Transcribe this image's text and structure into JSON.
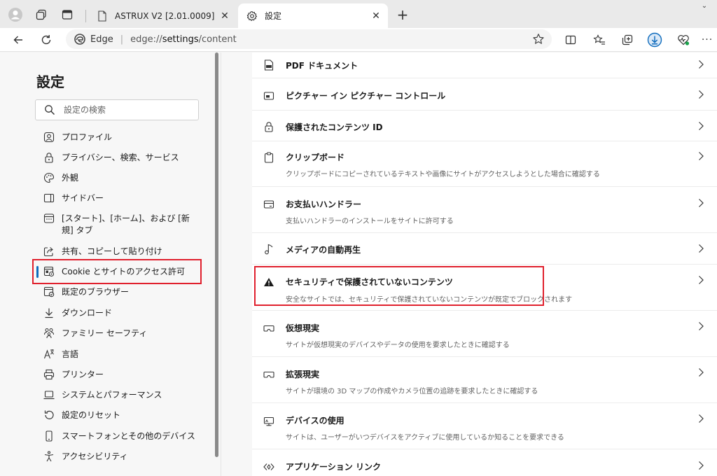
{
  "tabs": [
    {
      "title": "ASTRUX V2 [2.01.0009]",
      "icon": "document-icon",
      "active": false
    },
    {
      "title": "設定",
      "icon": "gear-icon",
      "active": true
    }
  ],
  "address_bar": {
    "site_label": "Edge",
    "url_prefix": "edge://",
    "url_path": "settings",
    "url_suffix": "/content"
  },
  "sidebar": {
    "title": "設定",
    "search_placeholder": "設定の検索",
    "items": [
      {
        "label": "プロファイル",
        "icon": "profile-icon"
      },
      {
        "label": "プライバシー、検索、サービス",
        "icon": "lock-icon"
      },
      {
        "label": "外観",
        "icon": "palette-icon"
      },
      {
        "label": "サイドバー",
        "icon": "sidebar-icon"
      },
      {
        "label": "[スタート]、[ホーム]、および [新規] タブ",
        "icon": "home-tab-icon"
      },
      {
        "label": "共有、コピーして貼り付け",
        "icon": "share-icon"
      },
      {
        "label": "Cookie とサイトのアクセス許可",
        "icon": "cookie-site-icon",
        "selected": true
      },
      {
        "label": "既定のブラウザー",
        "icon": "default-browser-icon"
      },
      {
        "label": "ダウンロード",
        "icon": "download-icon"
      },
      {
        "label": "ファミリー セーフティ",
        "icon": "family-icon"
      },
      {
        "label": "言語",
        "icon": "language-icon"
      },
      {
        "label": "プリンター",
        "icon": "printer-icon"
      },
      {
        "label": "システムとパフォーマンス",
        "icon": "laptop-icon"
      },
      {
        "label": "設定のリセット",
        "icon": "reset-icon"
      },
      {
        "label": "スマートフォンとその他のデバイス",
        "icon": "phone-icon"
      },
      {
        "label": "アクセシビリティ",
        "icon": "accessibility-icon"
      }
    ]
  },
  "content": {
    "rows": [
      {
        "title": "PDF ドキュメント",
        "description": "",
        "icon": "pdf-icon"
      },
      {
        "title": "ピクチャー イン ピクチャー コントロール",
        "description": "",
        "icon": "picture-in-picture-icon"
      },
      {
        "title": "保護されたコンテンツ ID",
        "description": "",
        "icon": "lock-icon"
      },
      {
        "title": "クリップボード",
        "description": "クリップボードにコピーされているテキストや画像にサイトがアクセスしようとした場合に確認する",
        "icon": "clipboard-icon"
      },
      {
        "title": "お支払いハンドラー",
        "description": "支払いハンドラーのインストールをサイトに許可する",
        "icon": "card-icon"
      },
      {
        "title": "メディアの自動再生",
        "description": "",
        "icon": "music-note-icon"
      },
      {
        "title": "セキュリティで保護されていないコンテンツ",
        "description": "安全なサイトでは、セキュリティで保護されていないコンテンツが既定でブロックされます",
        "icon": "warning-icon",
        "highlighted": true
      },
      {
        "title": "仮想現実",
        "description": "サイトが仮想現実のデバイスやデータの使用を要求したときに確認する",
        "icon": "vr-headset-icon"
      },
      {
        "title": "拡張現実",
        "description": "サイトが環境の 3D マップの作成やカメラ位置の追跡を要求したときに確認する",
        "icon": "ar-headset-icon"
      },
      {
        "title": "デバイスの使用",
        "description": "サイトは、ユーザーがいつデバイスをアクティブに使用しているか知ることを要求できる",
        "icon": "monitor-icon"
      },
      {
        "title": "アプリケーション リンク",
        "description": "",
        "icon": "app-link-icon"
      }
    ]
  },
  "colors": {
    "accent": "#0f6cbd",
    "highlight_border": "#e0202d",
    "download_button": "#0f6cbd"
  }
}
